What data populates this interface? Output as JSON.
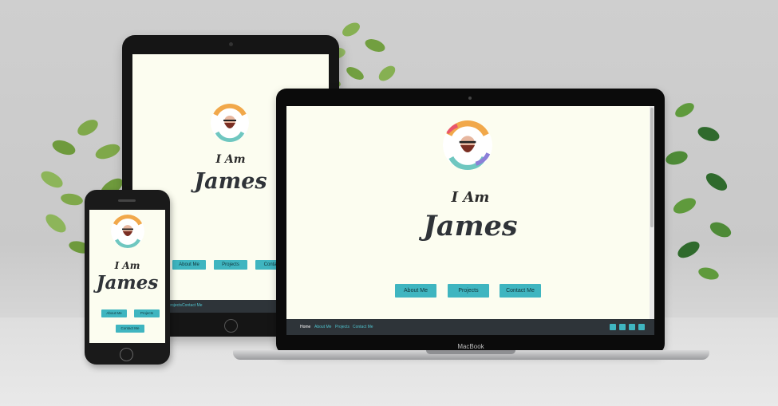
{
  "site": {
    "greeting": "I Am",
    "name": "James",
    "buttons": [
      "About Me",
      "Projects",
      "Contact Me"
    ],
    "footer_links": [
      "Home",
      "About Me",
      "Projects",
      "Contact Me"
    ],
    "social_icons": [
      "github-icon",
      "facebook-icon",
      "twitter-icon",
      "instagram-icon"
    ]
  },
  "tablet_partial": {
    "contact_fragment": "Contact",
    "footer_fragment": [
      "Projects",
      "Contact Me"
    ]
  },
  "laptop": {
    "brand": "MacBook"
  },
  "colors": {
    "accent": "#3fb5c0",
    "background": "#fcfdf0",
    "footer": "#2e3439",
    "text": "#2f3338"
  }
}
